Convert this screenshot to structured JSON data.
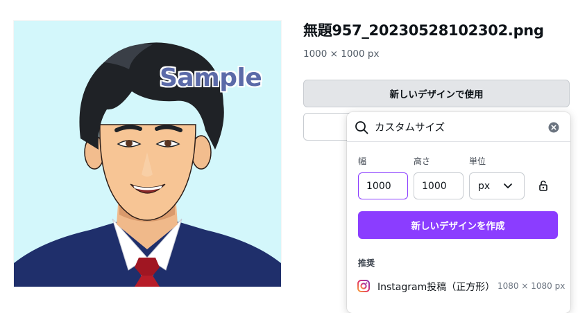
{
  "preview": {
    "watermark": "Sample",
    "background_color": "#d3f7fb"
  },
  "file": {
    "name": "無題957_20230528102302.png",
    "dimensions": "1000 × 1000 px"
  },
  "buttons": {
    "use_in_new_design": "新しいデザインで使用",
    "create_new_design": "新しいデザインを作成"
  },
  "dropdown": {
    "search_value": "カスタムサイズ",
    "icons": {
      "search": "search-icon",
      "clear": "clear-icon",
      "lock": "lock-icon",
      "chevron": "chevron-down-icon"
    },
    "width_label": "幅",
    "height_label": "高さ",
    "unit_label": "単位",
    "width_value": "1000",
    "height_value": "1000",
    "unit_value": "px",
    "section_label": "推奨",
    "suggestions": [
      {
        "name": "Instagram投稿（正方形）",
        "size": "1080 × 1080 px",
        "icon": "instagram-icon"
      }
    ]
  },
  "colors": {
    "accent": "#8b3dff",
    "button_gray": "#e3e5e8",
    "text_primary": "#0e1318"
  }
}
